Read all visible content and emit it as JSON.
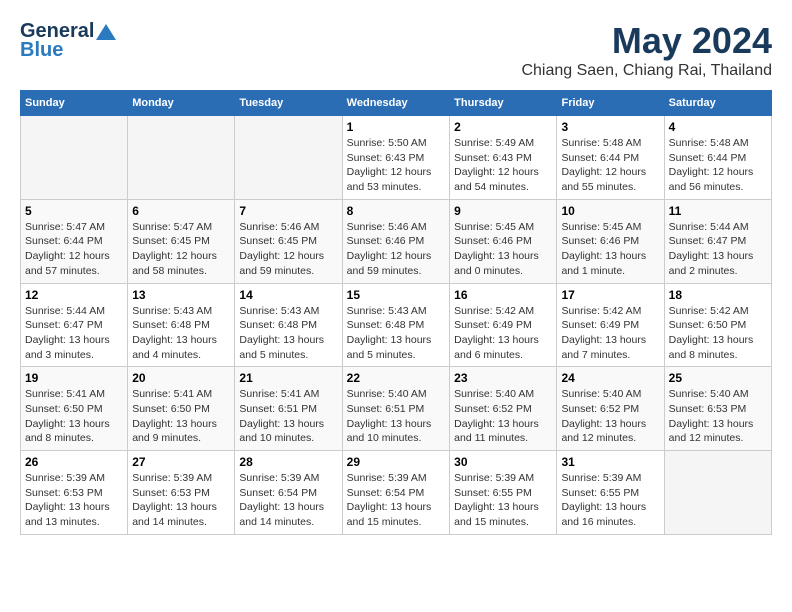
{
  "header": {
    "logo_general": "General",
    "logo_blue": "Blue",
    "month_title": "May 2024",
    "location": "Chiang Saen, Chiang Rai, Thailand"
  },
  "weekdays": [
    "Sunday",
    "Monday",
    "Tuesday",
    "Wednesday",
    "Thursday",
    "Friday",
    "Saturday"
  ],
  "weeks": [
    [
      {
        "day": "",
        "content": ""
      },
      {
        "day": "",
        "content": ""
      },
      {
        "day": "",
        "content": ""
      },
      {
        "day": "1",
        "content": "Sunrise: 5:50 AM\nSunset: 6:43 PM\nDaylight: 12 hours\nand 53 minutes."
      },
      {
        "day": "2",
        "content": "Sunrise: 5:49 AM\nSunset: 6:43 PM\nDaylight: 12 hours\nand 54 minutes."
      },
      {
        "day": "3",
        "content": "Sunrise: 5:48 AM\nSunset: 6:44 PM\nDaylight: 12 hours\nand 55 minutes."
      },
      {
        "day": "4",
        "content": "Sunrise: 5:48 AM\nSunset: 6:44 PM\nDaylight: 12 hours\nand 56 minutes."
      }
    ],
    [
      {
        "day": "5",
        "content": "Sunrise: 5:47 AM\nSunset: 6:44 PM\nDaylight: 12 hours\nand 57 minutes."
      },
      {
        "day": "6",
        "content": "Sunrise: 5:47 AM\nSunset: 6:45 PM\nDaylight: 12 hours\nand 58 minutes."
      },
      {
        "day": "7",
        "content": "Sunrise: 5:46 AM\nSunset: 6:45 PM\nDaylight: 12 hours\nand 59 minutes."
      },
      {
        "day": "8",
        "content": "Sunrise: 5:46 AM\nSunset: 6:46 PM\nDaylight: 12 hours\nand 59 minutes."
      },
      {
        "day": "9",
        "content": "Sunrise: 5:45 AM\nSunset: 6:46 PM\nDaylight: 13 hours\nand 0 minutes."
      },
      {
        "day": "10",
        "content": "Sunrise: 5:45 AM\nSunset: 6:46 PM\nDaylight: 13 hours\nand 1 minute."
      },
      {
        "day": "11",
        "content": "Sunrise: 5:44 AM\nSunset: 6:47 PM\nDaylight: 13 hours\nand 2 minutes."
      }
    ],
    [
      {
        "day": "12",
        "content": "Sunrise: 5:44 AM\nSunset: 6:47 PM\nDaylight: 13 hours\nand 3 minutes."
      },
      {
        "day": "13",
        "content": "Sunrise: 5:43 AM\nSunset: 6:48 PM\nDaylight: 13 hours\nand 4 minutes."
      },
      {
        "day": "14",
        "content": "Sunrise: 5:43 AM\nSunset: 6:48 PM\nDaylight: 13 hours\nand 5 minutes."
      },
      {
        "day": "15",
        "content": "Sunrise: 5:43 AM\nSunset: 6:48 PM\nDaylight: 13 hours\nand 5 minutes."
      },
      {
        "day": "16",
        "content": "Sunrise: 5:42 AM\nSunset: 6:49 PM\nDaylight: 13 hours\nand 6 minutes."
      },
      {
        "day": "17",
        "content": "Sunrise: 5:42 AM\nSunset: 6:49 PM\nDaylight: 13 hours\nand 7 minutes."
      },
      {
        "day": "18",
        "content": "Sunrise: 5:42 AM\nSunset: 6:50 PM\nDaylight: 13 hours\nand 8 minutes."
      }
    ],
    [
      {
        "day": "19",
        "content": "Sunrise: 5:41 AM\nSunset: 6:50 PM\nDaylight: 13 hours\nand 8 minutes."
      },
      {
        "day": "20",
        "content": "Sunrise: 5:41 AM\nSunset: 6:50 PM\nDaylight: 13 hours\nand 9 minutes."
      },
      {
        "day": "21",
        "content": "Sunrise: 5:41 AM\nSunset: 6:51 PM\nDaylight: 13 hours\nand 10 minutes."
      },
      {
        "day": "22",
        "content": "Sunrise: 5:40 AM\nSunset: 6:51 PM\nDaylight: 13 hours\nand 10 minutes."
      },
      {
        "day": "23",
        "content": "Sunrise: 5:40 AM\nSunset: 6:52 PM\nDaylight: 13 hours\nand 11 minutes."
      },
      {
        "day": "24",
        "content": "Sunrise: 5:40 AM\nSunset: 6:52 PM\nDaylight: 13 hours\nand 12 minutes."
      },
      {
        "day": "25",
        "content": "Sunrise: 5:40 AM\nSunset: 6:53 PM\nDaylight: 13 hours\nand 12 minutes."
      }
    ],
    [
      {
        "day": "26",
        "content": "Sunrise: 5:39 AM\nSunset: 6:53 PM\nDaylight: 13 hours\nand 13 minutes."
      },
      {
        "day": "27",
        "content": "Sunrise: 5:39 AM\nSunset: 6:53 PM\nDaylight: 13 hours\nand 14 minutes."
      },
      {
        "day": "28",
        "content": "Sunrise: 5:39 AM\nSunset: 6:54 PM\nDaylight: 13 hours\nand 14 minutes."
      },
      {
        "day": "29",
        "content": "Sunrise: 5:39 AM\nSunset: 6:54 PM\nDaylight: 13 hours\nand 15 minutes."
      },
      {
        "day": "30",
        "content": "Sunrise: 5:39 AM\nSunset: 6:55 PM\nDaylight: 13 hours\nand 15 minutes."
      },
      {
        "day": "31",
        "content": "Sunrise: 5:39 AM\nSunset: 6:55 PM\nDaylight: 13 hours\nand 16 minutes."
      },
      {
        "day": "",
        "content": ""
      }
    ]
  ]
}
